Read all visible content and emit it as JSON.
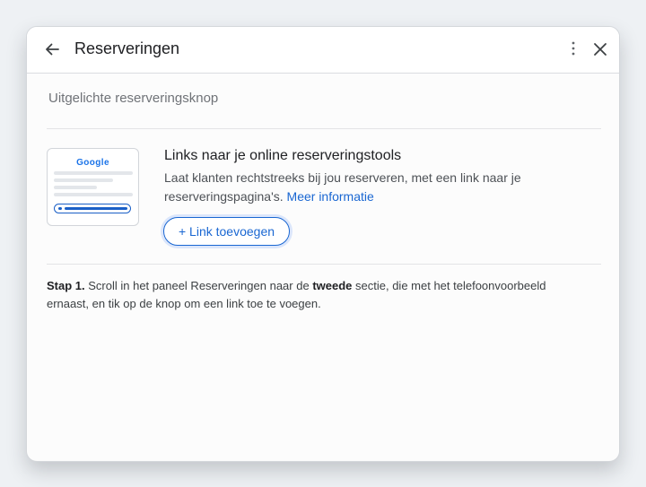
{
  "dialog": {
    "title": "Reserveringen",
    "icons": {
      "back": "arrow-back-icon",
      "more": "more-vert-icon",
      "close": "close-icon"
    }
  },
  "section": {
    "label": "Uitgelichte reserveringsknop"
  },
  "preview": {
    "logo_text": "Google"
  },
  "content": {
    "title": "Links naar je online reserveringstools",
    "description": "Laat klanten rechtstreeks bij jou reserveren, met een link naar je reserveringspagina's.",
    "more_info_link": "Meer informatie",
    "add_button_label": "+ Link toevoegen"
  },
  "instruction": {
    "step_label": "Stap 1.",
    "text_before": "Scroll in het paneel Reserveringen naar de",
    "emphasis": "tweede",
    "text_after": "sectie, die met het telefoonvoorbeeld ernaast, en tik op de knop om een link toe te voegen."
  },
  "colors": {
    "accent": "#1a67d2",
    "title_text": "#202124",
    "secondary_text": "#707378",
    "page_background": "#eef1f4"
  }
}
